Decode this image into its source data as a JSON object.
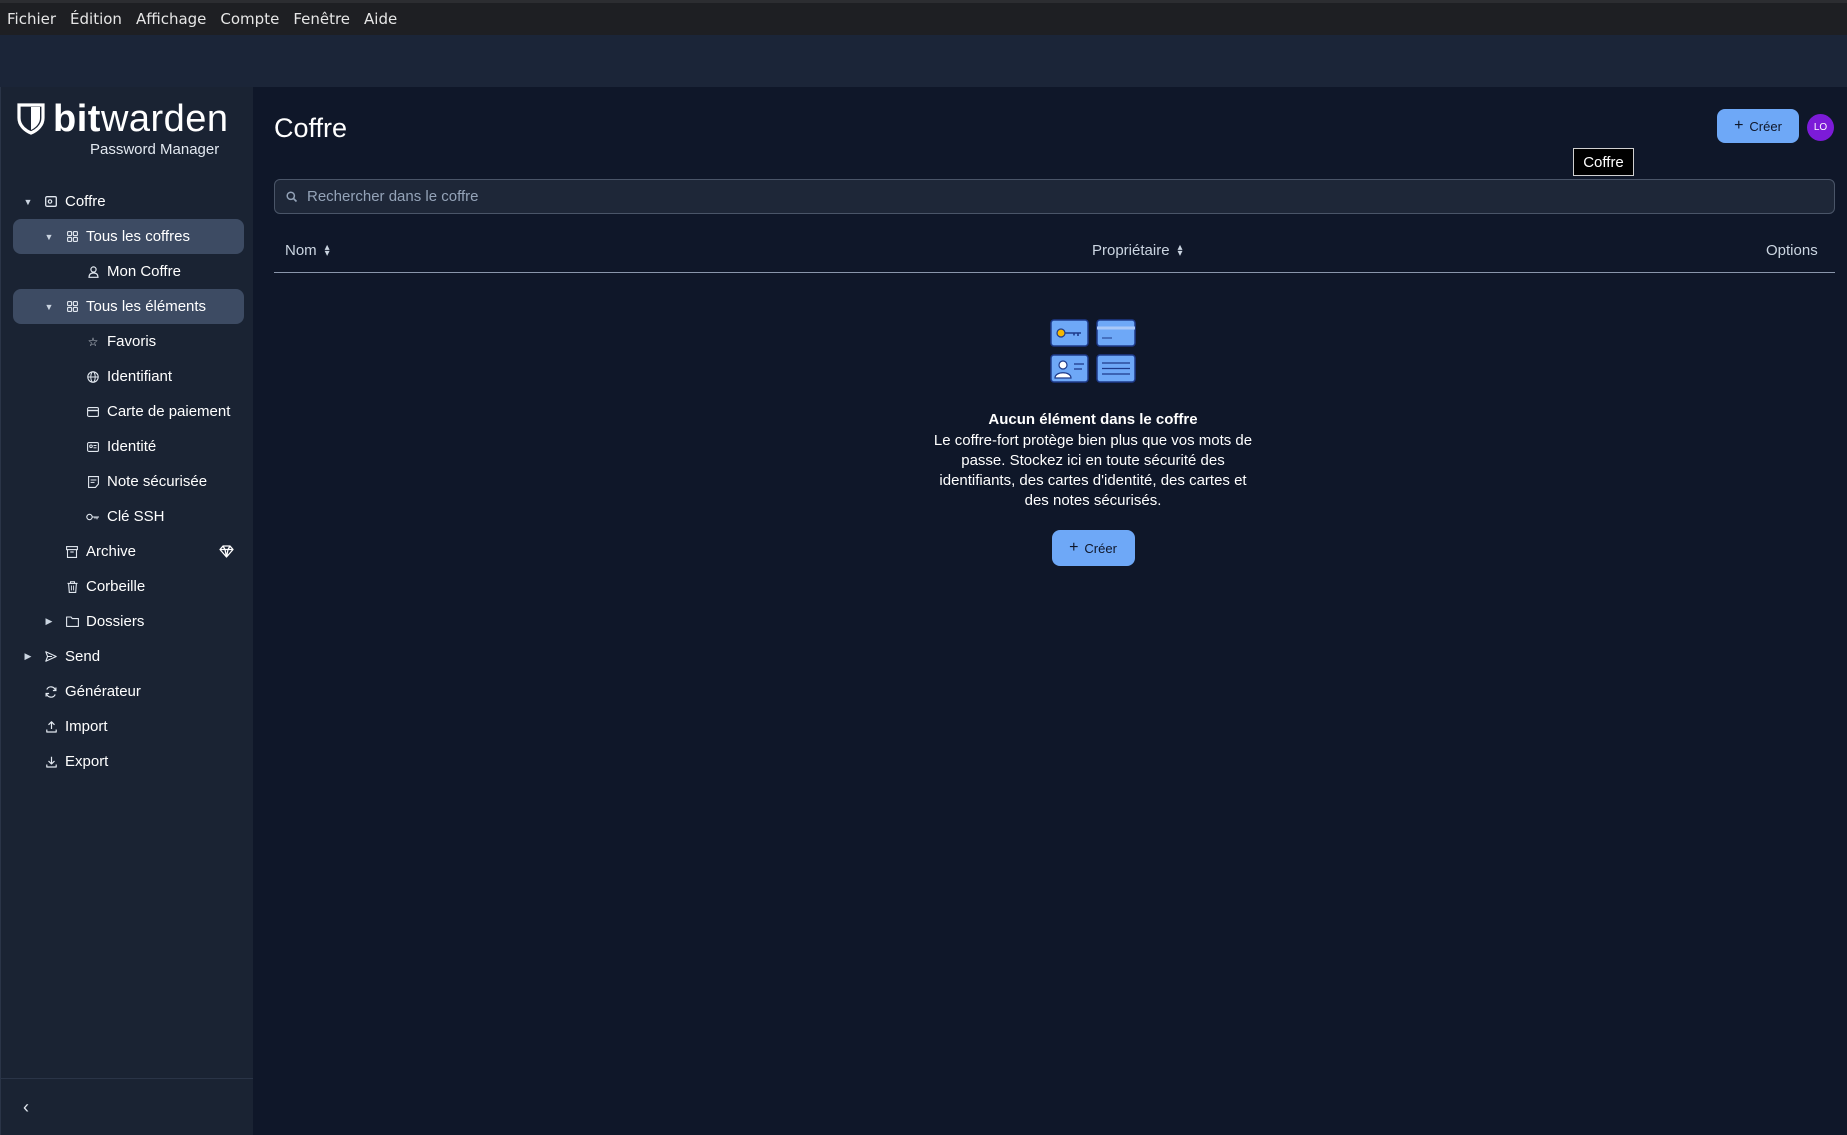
{
  "menubar": {
    "items": [
      "Fichier",
      "Édition",
      "Affichage",
      "Compte",
      "Fenêtre",
      "Aide"
    ]
  },
  "brand": {
    "bold": "bit",
    "light": "warden",
    "subtitle": "Password Manager"
  },
  "sidebar": {
    "items": [
      {
        "label": "Coffre",
        "icon": "vault-icon",
        "caret": "down"
      },
      {
        "label": "Tous les coffres",
        "icon": "grid-icon",
        "caret": "down",
        "active": true
      },
      {
        "label": "Mon Coffre",
        "icon": "user-icon"
      },
      {
        "label": "Tous les éléments",
        "icon": "grid-icon",
        "caret": "down",
        "active": true
      },
      {
        "label": "Favoris",
        "icon": "star-icon"
      },
      {
        "label": "Identifiant",
        "icon": "globe-icon"
      },
      {
        "label": "Carte de paiement",
        "icon": "credit-card-icon"
      },
      {
        "label": "Identité",
        "icon": "id-card-icon"
      },
      {
        "label": "Note sécurisée",
        "icon": "note-icon"
      },
      {
        "label": "Clé SSH",
        "icon": "key-icon"
      },
      {
        "label": "Archive",
        "icon": "archive-icon",
        "badge": "diamond-icon"
      },
      {
        "label": "Corbeille",
        "icon": "trash-icon"
      },
      {
        "label": "Dossiers",
        "icon": "folder-icon",
        "caret": "right"
      },
      {
        "label": "Send",
        "icon": "send-icon",
        "caret": "right"
      },
      {
        "label": "Générateur",
        "icon": "generator-icon"
      },
      {
        "label": "Import",
        "icon": "import-icon"
      },
      {
        "label": "Export",
        "icon": "export-icon"
      }
    ],
    "collapse_icon": "chevron-left-icon"
  },
  "main": {
    "title": "Coffre",
    "create_label": "Créer",
    "avatar_initials": "LO",
    "tooltip": "Coffre",
    "search_placeholder": "Rechercher dans le coffre",
    "columns": {
      "name": "Nom",
      "owner": "Propriétaire",
      "options": "Options"
    },
    "empty": {
      "title": "Aucun élément dans le coffre",
      "description": "Le coffre-fort protège bien plus que vos mots de passe. Stockez ici en toute sécurité des identifiants, des cartes d'identité, des cartes et des notes sécurisés.",
      "create_label": "Créer"
    }
  },
  "colors": {
    "accent": "#6ea8f7",
    "avatar": "#7c1bd8",
    "sidebar_bg": "#1a2333",
    "main_bg": "#0f1729",
    "active_item": "#3d4b63"
  }
}
